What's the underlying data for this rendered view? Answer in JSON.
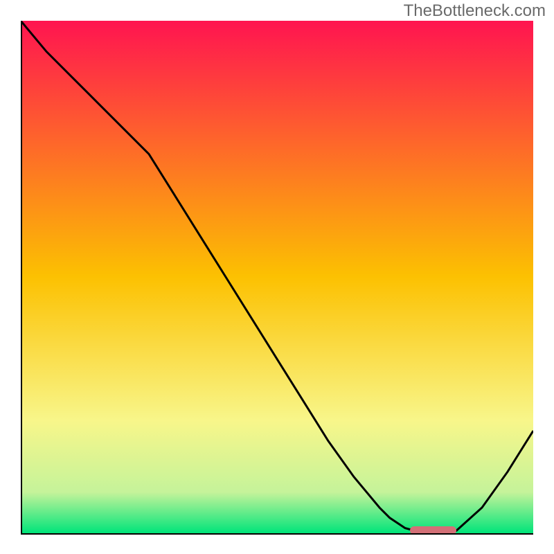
{
  "watermark": "TheBottleneck.com",
  "chart_data": {
    "type": "line",
    "title": "",
    "xlabel": "",
    "ylabel": "",
    "xlim": [
      0,
      100
    ],
    "ylim": [
      0,
      100
    ],
    "x": [
      0,
      5,
      10,
      15,
      20,
      25,
      30,
      35,
      40,
      45,
      50,
      55,
      60,
      65,
      70,
      72,
      75,
      78,
      80,
      82,
      85,
      90,
      95,
      100
    ],
    "values": [
      100,
      94,
      89,
      84,
      79,
      74,
      66,
      58,
      50,
      42,
      34,
      26,
      18,
      11,
      5,
      3,
      1,
      0.2,
      0,
      0,
      0.5,
      5,
      12,
      20
    ],
    "gradient_stops": [
      {
        "offset": 0.0,
        "color": "#ff1450"
      },
      {
        "offset": 0.5,
        "color": "#fcc101"
      },
      {
        "offset": 0.78,
        "color": "#f8f68a"
      },
      {
        "offset": 0.92,
        "color": "#c5f39a"
      },
      {
        "offset": 1.0,
        "color": "#00e47a"
      }
    ],
    "optimum_marker": {
      "x_start": 76,
      "x_end": 85,
      "y": 0,
      "color": "#d37077"
    }
  }
}
